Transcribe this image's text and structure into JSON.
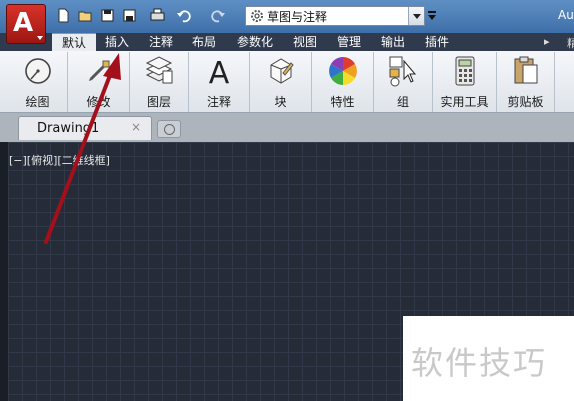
{
  "app": {
    "logo_letter": "A",
    "title_right": "Au",
    "workspace": {
      "label": "草图与注释"
    },
    "colors": {
      "accent": "#c0221b",
      "titlebar": "#4a7ab3",
      "canvas": "#252b37",
      "arrow": "#a3101c"
    }
  },
  "quick_access": {
    "icons": [
      "new-icon",
      "open-icon",
      "save-icon",
      "save-as-icon",
      "plot-icon",
      "undo-icon",
      "redo-icon"
    ]
  },
  "ribbon_tabs": [
    {
      "label": "默认",
      "active": true
    },
    {
      "label": "插入",
      "active": false
    },
    {
      "label": "注释",
      "active": false
    },
    {
      "label": "布局",
      "active": false
    },
    {
      "label": "参数化",
      "active": false
    },
    {
      "label": "视图",
      "active": false
    },
    {
      "label": "管理",
      "active": false
    },
    {
      "label": "输出",
      "active": false
    },
    {
      "label": "插件",
      "active": false
    }
  ],
  "ribbon_tab_overflow": "精",
  "ribbon_panels": [
    {
      "label": "绘图",
      "icon": "draw-circle-icon"
    },
    {
      "label": "修改",
      "icon": "modify-icon"
    },
    {
      "label": "图层",
      "icon": "layers-icon"
    },
    {
      "label": "注释",
      "icon": "annotation-text-icon"
    },
    {
      "label": "块",
      "icon": "block-icon"
    },
    {
      "label": "特性",
      "icon": "properties-color-wheel-icon"
    },
    {
      "label": "组",
      "icon": "group-icon"
    },
    {
      "label": "实用工具",
      "icon": "calculator-icon"
    },
    {
      "label": "剪贴板",
      "icon": "clipboard-icon"
    }
  ],
  "document": {
    "tab_name": "Drawing1",
    "close_glyph": "×"
  },
  "viewport": {
    "label": "[−][俯视][二维线框]"
  },
  "watermark": {
    "text": "软件技巧"
  }
}
